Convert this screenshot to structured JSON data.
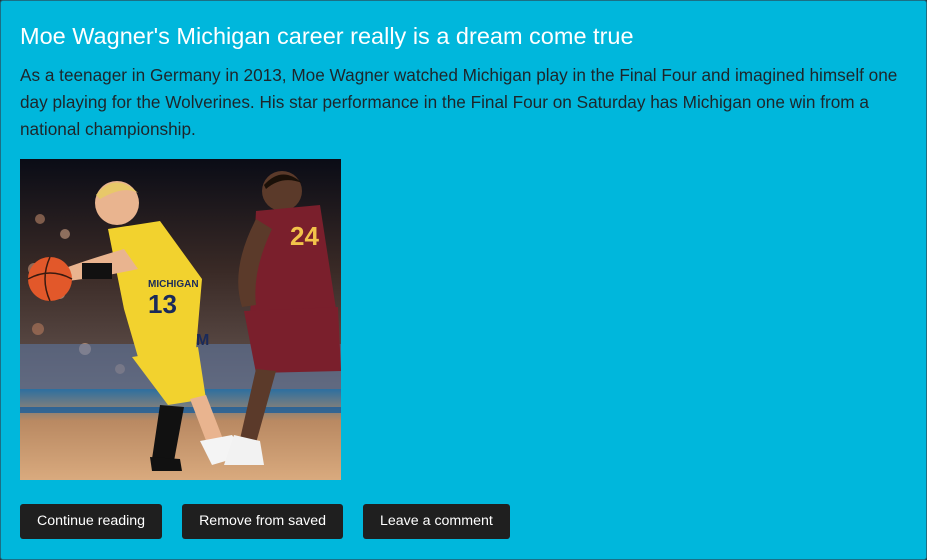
{
  "article": {
    "title": "Moe Wagner's Michigan career really is a dream come true",
    "summary": "As a teenager in Germany in 2013, Moe Wagner watched Michigan play in the Final Four and imagined himself one day playing for the Wolverines. His star performance in the Final Four on Saturday has Michigan one win from a national championship.",
    "image": {
      "jersey_yellow": "13",
      "jersey_maroon": "24",
      "chest_text": "MICHIGAN",
      "alt": "Moe Wagner dribbling past a Loyola-Chicago defender"
    }
  },
  "actions": {
    "continue_label": "Continue reading",
    "remove_label": "Remove from saved",
    "comment_label": "Leave a comment"
  },
  "colors": {
    "card_bg": "#00b7dc",
    "button_bg": "#1f1f1f",
    "michigan_maize": "#f2d22e",
    "loyola_maroon": "#7a1f2c"
  }
}
